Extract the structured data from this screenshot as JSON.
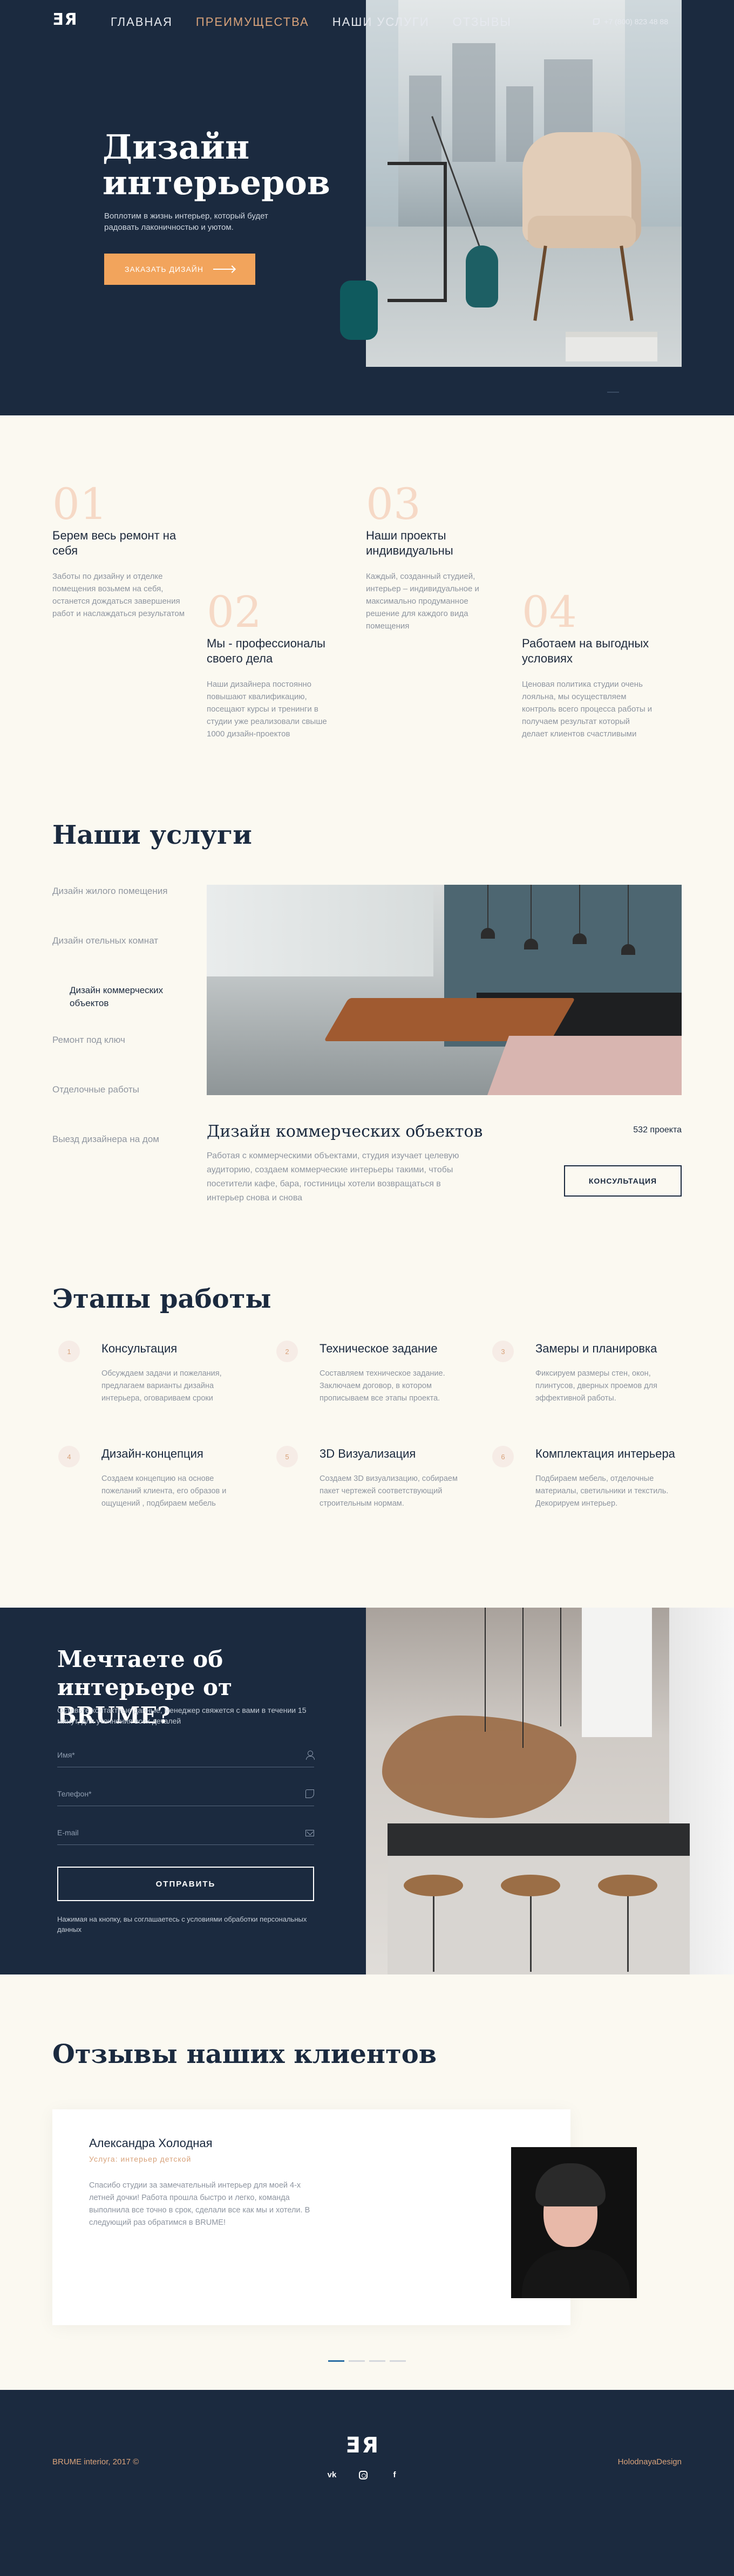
{
  "nav": {
    "logo": "ƎЯ",
    "links": [
      "ГЛАВНАЯ",
      "ПРЕИМУЩЕСТВА",
      "НАШИ УСЛУГИ",
      "ОТЗЫВЫ"
    ],
    "phone": "+7 (800) 823  48 88"
  },
  "hero": {
    "title": "Дизайн интерьеров",
    "subtitle": "Воплотим в жизнь интерьер, который будет радовать лаконичностью и уютом.",
    "button": "ЗАКАЗАТЬ ДИЗАЙН"
  },
  "advantages": [
    {
      "num": "01",
      "title": "Берем весь ремонт на себя",
      "text": "Заботы по дизайну и отделке помещения возьмем на себя, останется дождаться завершения работ и наслаждаться результатом"
    },
    {
      "num": "02",
      "title": "Мы - профессионалы своего дела",
      "text": "Наши дизайнера постоянно повышают квалификацию, посещают курсы и тренинги в студии уже реализовали свыше 1000 дизайн-проектов"
    },
    {
      "num": "03",
      "title": "Наши проекты индивидуальны",
      "text": "Каждый, созданный студией, интерьер – индивидуальное и максимально продуманное решение для каждого вида помещения"
    },
    {
      "num": "04",
      "title": "Работаем на выгодных условиях",
      "text": "Ценовая политика студии очень лояльна,  мы осуществляем контроль всего процесса работы и получаем результат который делает клиентов счастливыми"
    }
  ],
  "services": {
    "title": "Наши услуги",
    "items": [
      "Дизайн жилого помещения",
      "Дизайн отельных комнат",
      "Дизайн коммерческих объектов",
      "Ремонт под ключ",
      "Отделочные работы",
      "Выезд дизайнера на дом"
    ],
    "active_name": "Дизайн коммерческих объектов",
    "count": "532 проекта",
    "description": "Работая с коммерческими объектами, студия изучает целевую аудиторию, создаем коммерческие интерьеры такими, чтобы посетители кафе, бара, гостиницы хотели возвращаться в интерьер снова и снова",
    "button": "КОНСУЛЬТАЦИЯ"
  },
  "stages": {
    "title": "Этапы работы",
    "items": [
      {
        "num": "1",
        "title": "Консультация",
        "text": "Обсуждаем задачи и пожелания, предлагаем варианты дизайна интерьера, оговариваем сроки"
      },
      {
        "num": "2",
        "title": "Техническое задание",
        "text": "Составляем техническое задание. Заключаем договор, в котором прописываем все этапы проекта."
      },
      {
        "num": "3",
        "title": "Замеры и планировка",
        "text": "Фиксируем размеры стен, окон, плинтусов, дверных проемов  для эффективной работы."
      },
      {
        "num": "4",
        "title": "Дизайн-концепция",
        "text": "Создаем концепцию на основе пожеланий клиента, его образов и ощущений , подбираем мебель"
      },
      {
        "num": "5",
        "title": "3D Визуализация",
        "text": "Создаем 3D визуализацию, собираем пакет чертежей соответствующий строительным нормам."
      },
      {
        "num": "6",
        "title": "Комплектация интерьера",
        "text": "Подбираем мебель, отделочные материалы, светильники и текстиль. Декорируем интерьер."
      }
    ]
  },
  "contact": {
    "title": "Мечтаете об интерьере от BRUME?",
    "subtitle": "Оставьте контактные данные, менеджер свяжется с вами в течении 15 минут, для уточнения всех деталей",
    "name_placeholder": "Имя*",
    "phone_placeholder": "Телефон*",
    "email_placeholder": "E-mail",
    "button": "ОТПРАВИТЬ",
    "note": "Нажимая на кнопку, вы соглашаетесь с условиями обработки персональных данных"
  },
  "reviews": {
    "title": "Отзывы наших клиентов",
    "name": "Александра Холодная",
    "service": "Услуга: интерьер детской",
    "text": "Спасибо студии за замечательный интерьер для моей 4-х летней дочки! Работа прошла быстро и легко, команда выполнила все точно в срок, сделали все как  мы и хотели. В следующий раз обратимся в BRUME!"
  },
  "footer": {
    "logo": "ƎЯ",
    "copyright": "BRUME interior, 2017  ©",
    "author": "HolodnayaDesign",
    "socials": [
      "vk-icon",
      "instagram-icon",
      "facebook-icon"
    ]
  },
  "colors": {
    "navy": "#1b2a3f",
    "accent": "#f2a45c",
    "cream": "#fbf9f1"
  }
}
